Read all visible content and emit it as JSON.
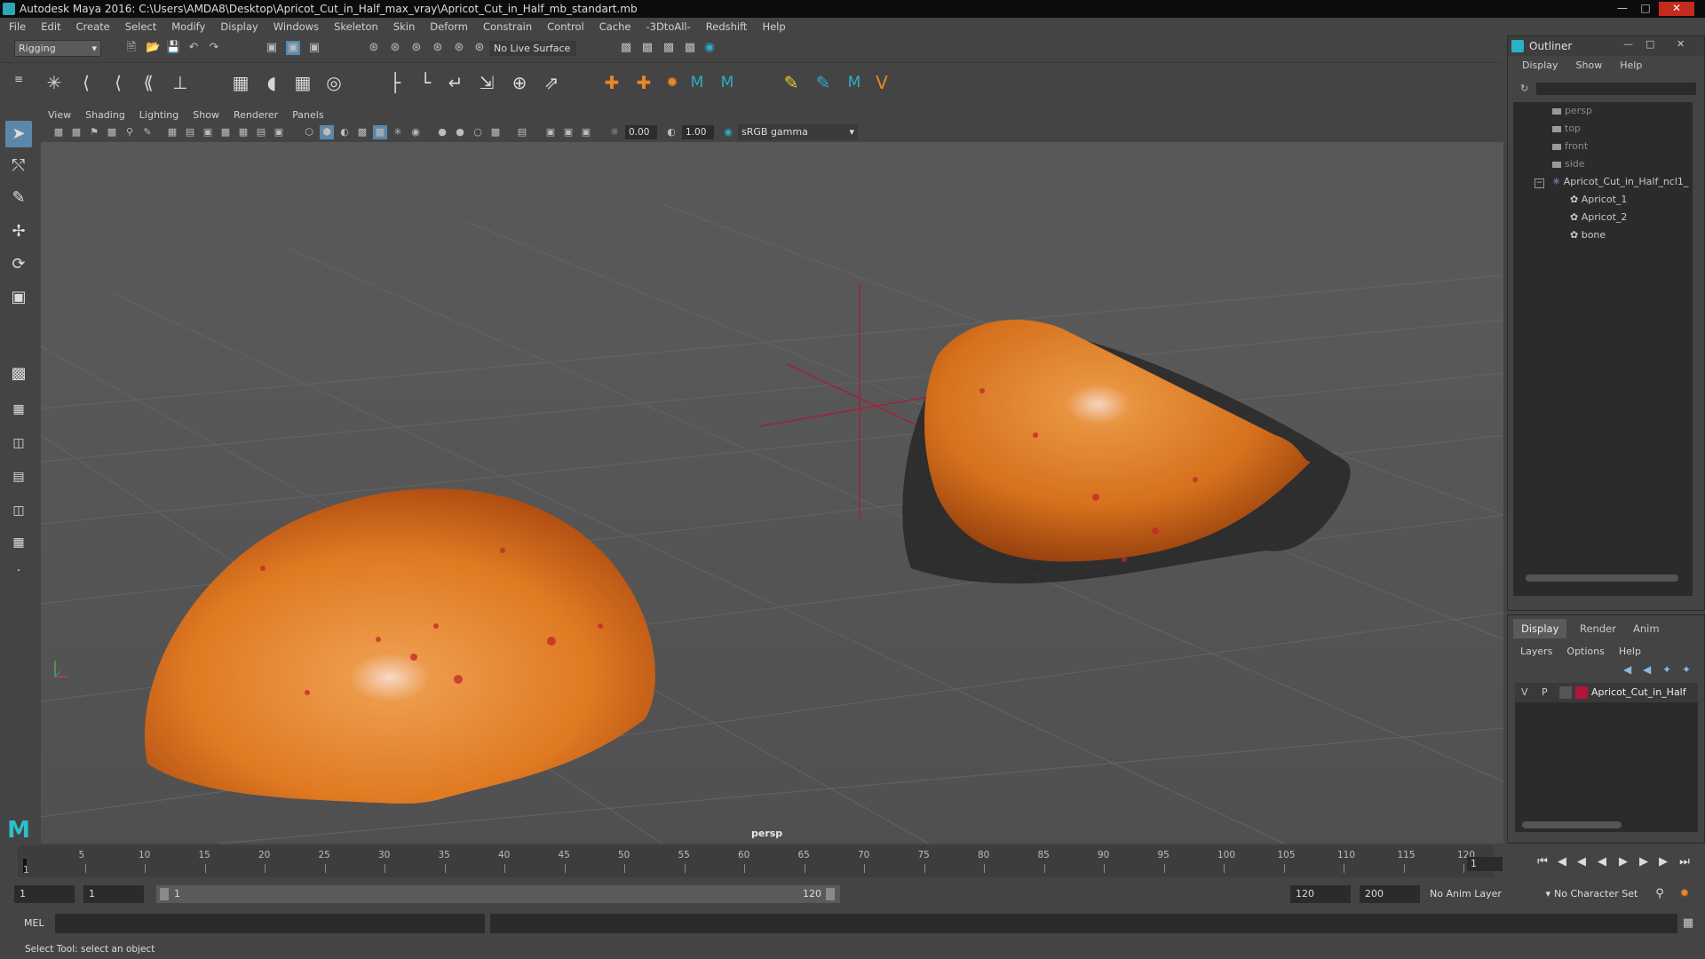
{
  "window": {
    "title": "Autodesk Maya 2016: C:\\Users\\AMDA8\\Desktop\\Apricot_Cut_in_Half_max_vray\\Apricot_Cut_in_Half_mb_standart.mb"
  },
  "menubar": [
    "File",
    "Edit",
    "Create",
    "Select",
    "Modify",
    "Display",
    "Windows",
    "Skeleton",
    "Skin",
    "Deform",
    "Constrain",
    "Control",
    "Cache",
    "-3DtoAll-",
    "Redshift",
    "Help"
  ],
  "toolbar": {
    "mode": "Rigging",
    "live_surface": "No Live Surface"
  },
  "panel": {
    "menu": [
      "View",
      "Shading",
      "Lighting",
      "Show",
      "Renderer",
      "Panels"
    ],
    "exposure": "0.00",
    "gamma": "1.00",
    "color_space": "sRGB gamma",
    "camera_label": "persp"
  },
  "outliner": {
    "title": "Outliner",
    "menu": [
      "Display",
      "Show",
      "Help"
    ],
    "items": [
      "persp",
      "top",
      "front",
      "side",
      "Apricot_Cut_in_Half_ncl1_",
      "Apricot_1",
      "Apricot_2",
      "bone"
    ]
  },
  "layers": {
    "tabs": [
      "Display",
      "Render",
      "Anim"
    ],
    "menu": [
      "Layers",
      "Options",
      "Help"
    ],
    "row": {
      "v": "V",
      "p": "P",
      "name": "Apricot_Cut_in_Half",
      "color": "#b0163a"
    }
  },
  "timeline": {
    "ticks": [
      "5",
      "10",
      "15",
      "20",
      "25",
      "30",
      "35",
      "40",
      "45",
      "50",
      "55",
      "60",
      "65",
      "70",
      "75",
      "80",
      "85",
      "90",
      "95",
      "100",
      "105",
      "110",
      "115",
      "120"
    ],
    "start_marker": "1",
    "current_frame": "1"
  },
  "range": {
    "start": "1",
    "playback_start": "1",
    "slider_start": "1",
    "slider_end": "120",
    "playback_end": "120",
    "end": "200",
    "anim_layer": "No Anim Layer",
    "character_set": "No Character Set"
  },
  "command": {
    "lang": "MEL"
  },
  "helpline": "Select Tool: select an object"
}
